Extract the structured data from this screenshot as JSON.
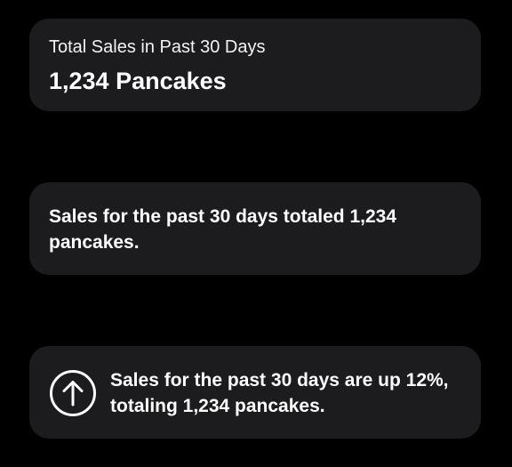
{
  "colors": {
    "background": "#000000",
    "card": "#1c1c1e",
    "text": "#ffffff"
  },
  "stat_card": {
    "label": "Total Sales in Past 30 Days",
    "value": "1,234 Pancakes"
  },
  "summary_card": {
    "text": "Sales for the past 30 days totaled 1,234 pancakes."
  },
  "trend_card": {
    "icon": "arrow-up-circle-icon",
    "text": "Sales for the past 30 days are up 12%, totaling 1,234 pancakes."
  }
}
